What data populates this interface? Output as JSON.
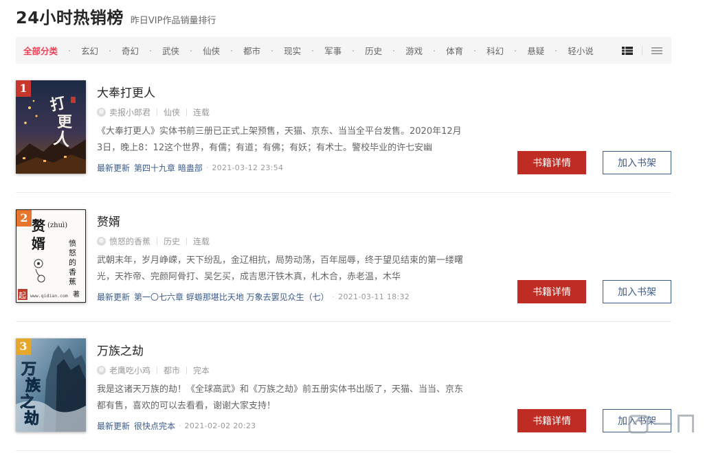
{
  "header": {
    "title": "24小时热销榜",
    "subtitle": "昨日VIP作品销量排行"
  },
  "categories": [
    "全部分类",
    "玄幻",
    "奇幻",
    "武侠",
    "仙侠",
    "都市",
    "现实",
    "军事",
    "历史",
    "游戏",
    "体育",
    "科幻",
    "悬疑",
    "轻小说"
  ],
  "active_category": "全部分类",
  "view_toggles": {
    "grid_icon": "grid-view-icon",
    "list_icon": "list-view-icon"
  },
  "books": [
    {
      "rank": "1",
      "rank_color": "#c8372d",
      "title": "大奉打更人",
      "author": "卖报小郎君",
      "genre": "仙侠",
      "status": "连载",
      "description": "《大奉打更人》实体书前三册已正式上架预售，天猫、京东、当当全平台发售。2020年12月3日，晚上8：12这个世界，有儒；有道；有佛；有妖；有术士。警校毕业的许七安幽",
      "update_label": "最新更新",
      "update_chapter": "第四十九章 暗蛊部",
      "update_time": "2021-03-12 23:54",
      "cover_title": "打更人"
    },
    {
      "rank": "2",
      "rank_color": "#e6752d",
      "title": "赘婿",
      "author": "愤怒的香蕉",
      "genre": "历史",
      "status": "连载",
      "description": "武朝末年，岁月峥嵘，天下纷乱，金辽相抗，局势动荡，百年屈辱，终于望见结束的第一缕曙光，天祚帝、完颜阿骨打、吴乞买，成吉思汗铁木真，札木合，赤老温，木华",
      "update_label": "最新更新",
      "update_chapter": "第一〇七六章 蜉蝣那堪比天地 万象去罢见众生（七）",
      "update_time": "2021-03-11 18:32",
      "cover_title": "赘婿",
      "cover_pinyin": "(zhuì)",
      "cover_author": "愤怒的香蕉",
      "cover_footer": "www.qidian.com",
      "cover_suffix": "著",
      "cover_logo": "起"
    },
    {
      "rank": "3",
      "rank_color": "#e6a72d",
      "title": "万族之劫",
      "author": "老鹰吃小鸡",
      "genre": "都市",
      "status": "完本",
      "description": "我是这诸天万族的劫！《全球高武》和《万族之劫》前五册实体书出版了，天猫、当当、京东都有售，喜欢的可以去看看，谢谢大家支持！",
      "update_label": "最新更新",
      "update_chapter": "很快点完本",
      "update_time": "2021-02-02 20:23",
      "cover_title": "万族之劫"
    }
  ],
  "buttons": {
    "detail": "书籍详情",
    "shelf": "加入书架"
  }
}
